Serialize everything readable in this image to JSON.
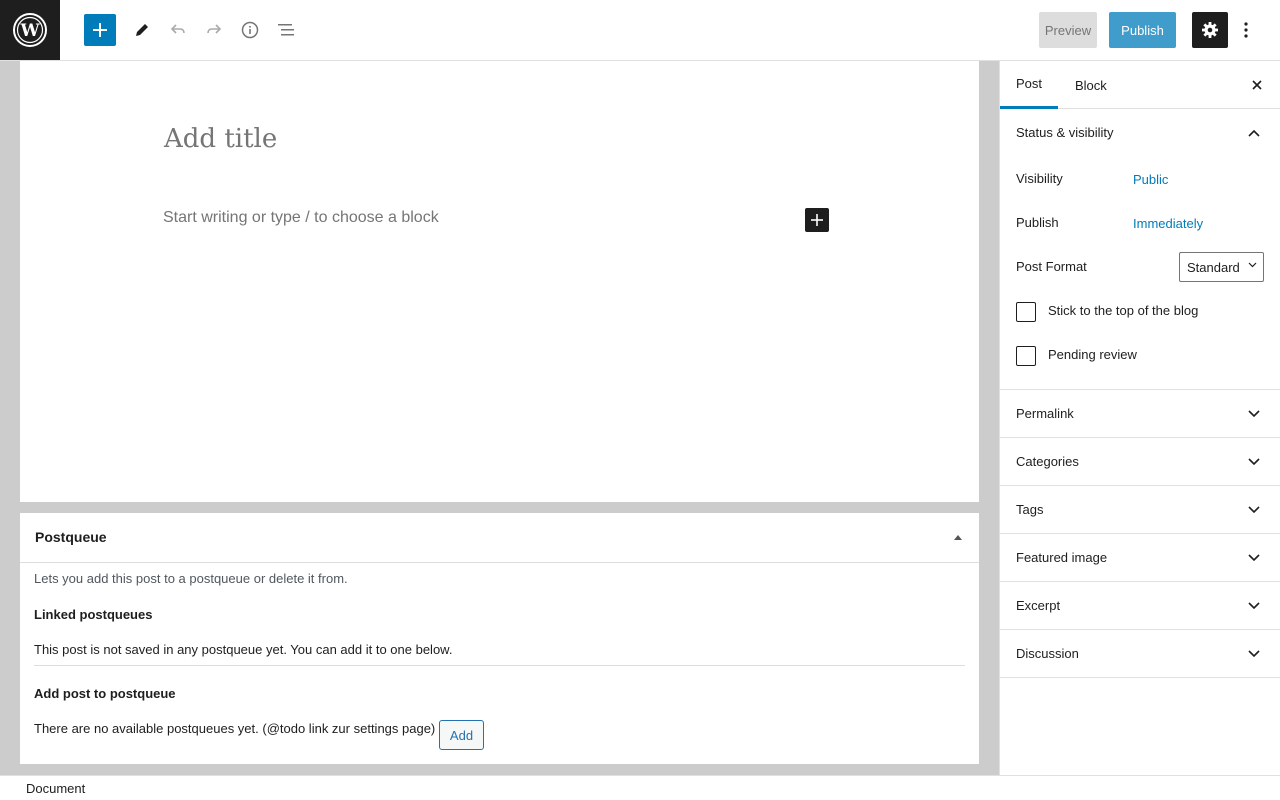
{
  "topbar": {
    "logo_icon": "wordpress-logo-icon",
    "inserter_icon": "plus-icon",
    "tools": [
      "pencil-icon",
      "undo-icon",
      "redo-icon",
      "info-icon",
      "list-view-icon"
    ],
    "preview_label": "Preview",
    "publish_label": "Publish",
    "settings_icon": "gear-icon",
    "more_icon": "more-vertical-icon",
    "accent_color": "#007cba"
  },
  "editor": {
    "title_placeholder": "Add title",
    "paragraph_placeholder": "Start writing or type / to choose a block"
  },
  "metabox": {
    "title": "Postqueue",
    "description": "Lets you add this post to a postqueue or delete it from.",
    "linked_heading": "Linked postqueues",
    "linked_note": "This post is not saved in any postqueue yet. You can add it to one below.",
    "add_heading": "Add post to postqueue",
    "empty_note": "There are no available postqueues yet. (@todo link zur settings page)",
    "add_button": "Add"
  },
  "footer": {
    "breadcrumb": "Document"
  },
  "sidebar": {
    "tabs": [
      {
        "label": "Post",
        "active": true
      },
      {
        "label": "Block",
        "active": false
      }
    ],
    "status_panel": {
      "title": "Status & visibility",
      "visibility_label": "Visibility",
      "visibility_value": "Public",
      "publish_label": "Publish",
      "publish_value": "Immediately",
      "format_label": "Post Format",
      "format_value": "Standard",
      "sticky_label": "Stick to the top of the blog",
      "sticky_checked": false,
      "pending_label": "Pending review",
      "pending_checked": false
    },
    "panels": [
      {
        "title": "Permalink"
      },
      {
        "title": "Categories"
      },
      {
        "title": "Tags"
      },
      {
        "title": "Featured image"
      },
      {
        "title": "Excerpt"
      },
      {
        "title": "Discussion"
      }
    ]
  }
}
